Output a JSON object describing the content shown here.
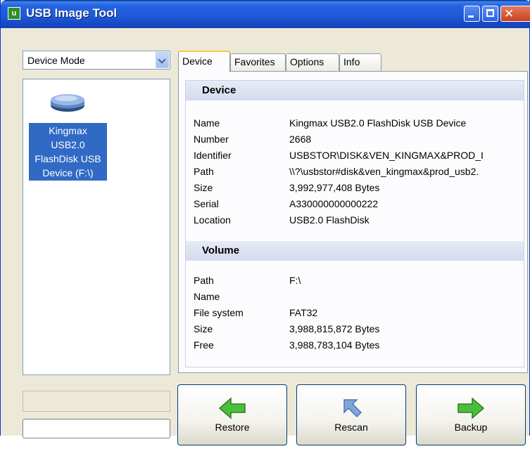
{
  "window": {
    "title": "USB Image Tool",
    "app_icon_letter": "u"
  },
  "left_panel": {
    "mode_select": {
      "value": "Device Mode"
    },
    "devices": [
      {
        "label_lines": [
          "Kingmax",
          "USB2.0",
          "FlashDisk USB",
          "Device (F:\\)"
        ],
        "selected": true,
        "icon": "usb-drive-icon"
      }
    ]
  },
  "tabs": [
    {
      "label": "Device",
      "active": true
    },
    {
      "label": "Favorites",
      "active": false
    },
    {
      "label": "Options",
      "active": false
    },
    {
      "label": "Info",
      "active": false
    }
  ],
  "device_section": {
    "header": "Device",
    "rows": [
      {
        "label": "Name",
        "value": "Kingmax USB2.0 FlashDisk USB Device"
      },
      {
        "label": "Number",
        "value": "2668"
      },
      {
        "label": "Identifier",
        "value": "USBSTOR\\DISK&VEN_KINGMAX&PROD_I"
      },
      {
        "label": "Path",
        "value": "\\\\?\\usbstor#disk&ven_kingmax&prod_usb2."
      },
      {
        "label": "Size",
        "value": "3,992,977,408 Bytes"
      },
      {
        "label": "Serial",
        "value": "A330000000000222"
      },
      {
        "label": "Location",
        "value": "USB2.0 FlashDisk"
      }
    ]
  },
  "volume_section": {
    "header": "Volume",
    "rows": [
      {
        "label": "Path",
        "value": "F:\\"
      },
      {
        "label": "Name",
        "value": ""
      },
      {
        "label": "File system",
        "value": "FAT32"
      },
      {
        "label": "Size",
        "value": "3,988,815,872 Bytes"
      },
      {
        "label": "Free",
        "value": "3,988,783,104 Bytes"
      }
    ]
  },
  "actions": {
    "restore": {
      "label": "Restore",
      "icon": "arrow-left-icon",
      "color": "#4cbf3a"
    },
    "rescan": {
      "label": "Rescan",
      "icon": "arrow-rescan-icon",
      "color": "#7fa7d8"
    },
    "backup": {
      "label": "Backup",
      "icon": "arrow-right-icon",
      "color": "#4cbf3a"
    }
  },
  "colors": {
    "titlebar": "#2663e0",
    "selection": "#316ac5",
    "tab_highlight": "#ffc83c"
  }
}
